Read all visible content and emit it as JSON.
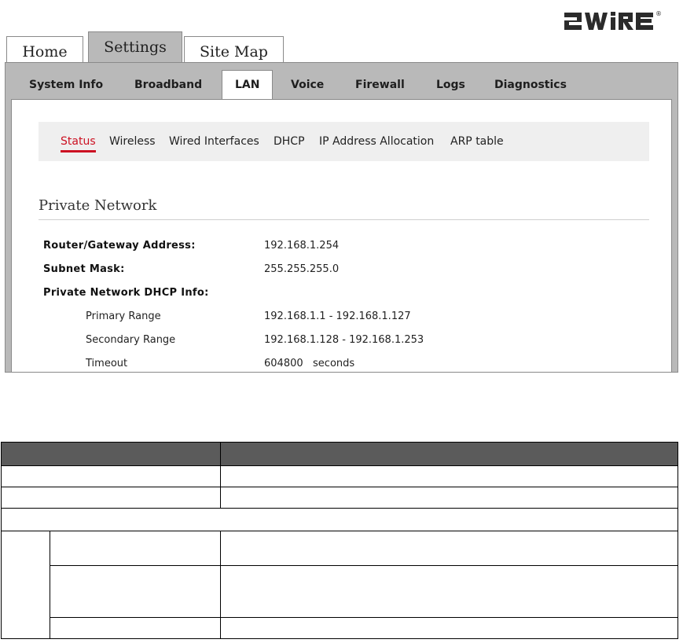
{
  "logo": {
    "text": "2WIRE",
    "trademark": "®"
  },
  "main_tabs": [
    {
      "label": "Home"
    },
    {
      "label": "Settings",
      "active": true
    },
    {
      "label": "Site Map"
    }
  ],
  "sub_tabs": [
    {
      "label": "System Info"
    },
    {
      "label": "Broadband"
    },
    {
      "label": "LAN",
      "active": true
    },
    {
      "label": "Voice"
    },
    {
      "label": "Firewall"
    },
    {
      "label": "Logs"
    },
    {
      "label": "Diagnostics"
    }
  ],
  "lan_nav": [
    {
      "label": "Status",
      "active": true
    },
    {
      "label": "Wireless"
    },
    {
      "label": "Wired Interfaces"
    },
    {
      "label": "DHCP"
    },
    {
      "label": "IP Address Allocation"
    },
    {
      "label": "ARP table"
    }
  ],
  "private_network": {
    "title": "Private Network",
    "router_label": "Router/Gateway Address:",
    "router_value": "192.168.1.254",
    "subnet_label": "Subnet Mask:",
    "subnet_value": "255.255.255.0",
    "dhcp_label": "Private Network DHCP Info:",
    "primary_label": "Primary Range",
    "primary_value": "192.168.1.1 - 192.168.1.127",
    "secondary_label": "Secondary Range",
    "secondary_value": "192.168.1.128 - 192.168.1.253",
    "timeout_label": "Timeout",
    "timeout_value": "604800   seconds"
  },
  "colors": {
    "accent": "#cc1122",
    "panel": "#b9b9b9",
    "table_header": "#5b5b5b"
  }
}
